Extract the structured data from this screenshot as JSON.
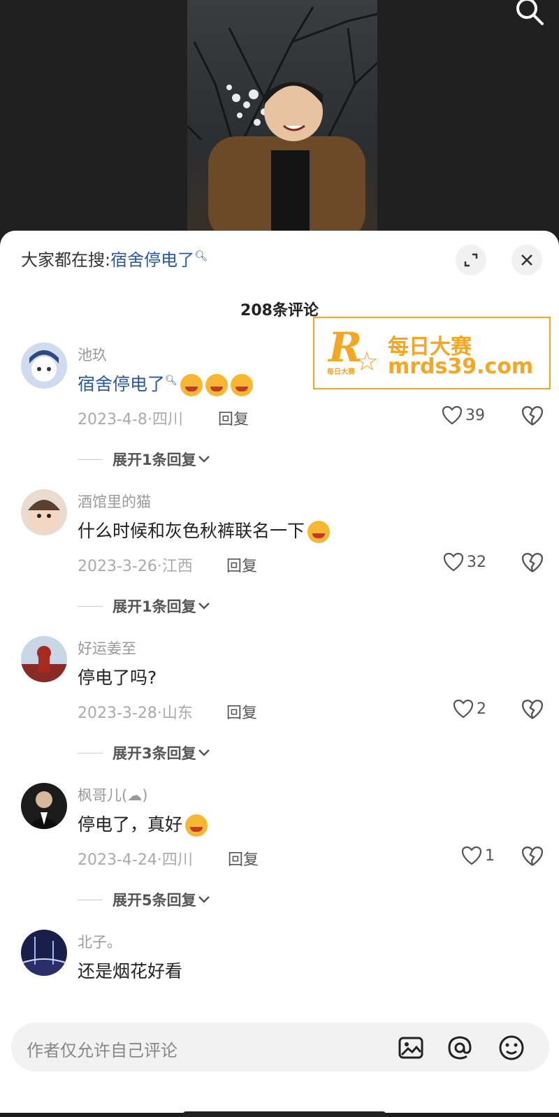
{
  "video": {
    "search_icon": "search-icon"
  },
  "panel": {
    "hot_search_label": "大家都在搜:",
    "hot_search_keyword": "宿舍停电了",
    "comment_count": "208条评论"
  },
  "watermark": {
    "logo_letter": "R",
    "line1": "每日大赛",
    "line2": "mrds39.com",
    "small": "每日大赛"
  },
  "comments": [
    {
      "user": "池玖",
      "text": "宿舍停电了",
      "has_keyword": true,
      "emoji_count": 3,
      "date_loc": "2023-4-8·四川",
      "reply": "回复",
      "likes": "39",
      "expand": "展开1条回复"
    },
    {
      "user": "酒馆里的猫",
      "text": "什么时候和灰色秋裤联名一下",
      "emoji_count": 1,
      "date_loc": "2023-3-26·江西",
      "reply": "回复",
      "likes": "32",
      "expand": "展开1条回复"
    },
    {
      "user": "好运姜至",
      "text": "停电了吗?",
      "emoji_count": 0,
      "date_loc": "2023-3-28·山东",
      "reply": "回复",
      "likes": "2",
      "expand": "展开3条回复"
    },
    {
      "user": "枫哥儿(☁)",
      "text": "停电了，真好",
      "emoji_count": 1,
      "date_loc": "2023-4-24·四川",
      "reply": "回复",
      "likes": "1",
      "expand": "展开5条回复"
    },
    {
      "user": "北子。",
      "text": "还是烟花好看",
      "emoji_count": 0
    }
  ],
  "input": {
    "placeholder": "作者仅允许自己评论"
  },
  "colors": {
    "keyword": "#2a5a9e",
    "watermark": "#f5a623"
  }
}
